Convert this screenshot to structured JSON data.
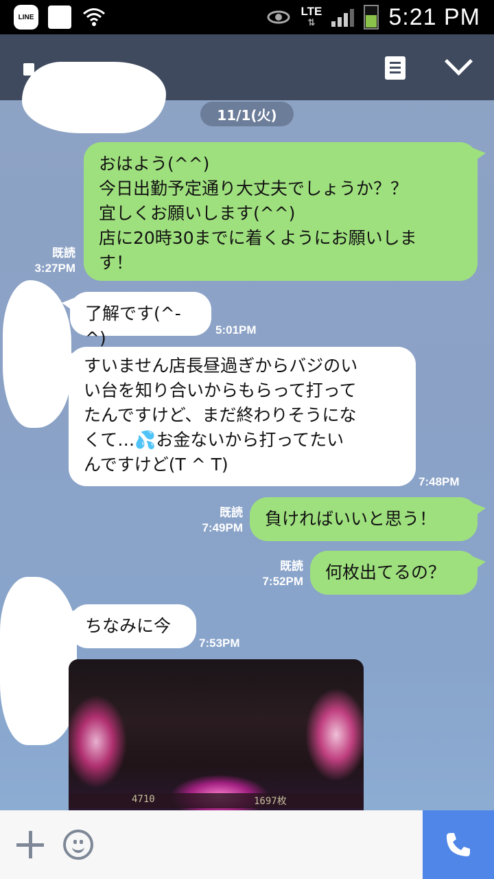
{
  "status_bar": {
    "line_label": "LINE",
    "network": "LTE",
    "time": "5:21 PM"
  },
  "header": {
    "icons": [
      "lock-icon",
      "notes-icon",
      "chevron-down-icon"
    ]
  },
  "chat": {
    "date": "11/1(火)",
    "read_label": "既読",
    "messages": [
      {
        "side": "sent",
        "text": "おはよう(^^)\n今日出勤予定通り大丈夫でしょうか？？\n宜しくお願いします(^^)\n店に20時30までに着くようにお願いしま\nす！",
        "time": "3:27PM",
        "read": "既読"
      },
      {
        "side": "recv",
        "text": "了解です(^-^)",
        "time": "5:01PM"
      },
      {
        "side": "recv",
        "text": "すいません店長昼過ぎからバジのい\nい台を知り合いからもらって打って\nたんですけど、まだ終わりそうにな\nくて…💦お金ないから打ってたい\nんですけど(T ^ T)",
        "time": "7:48PM"
      },
      {
        "side": "sent",
        "text": "負ければいいと思う！",
        "time": "7:49PM",
        "read": "既読"
      },
      {
        "side": "sent",
        "text": "何枚出てるの？",
        "time": "7:52PM",
        "read": "既読"
      },
      {
        "side": "recv",
        "text": "ちなみに今",
        "time": "7:53PM"
      }
    ],
    "photo": {
      "left_counter": "4710",
      "right_counter": "1697枚"
    }
  },
  "input_bar": {
    "icons": [
      "plus-icon",
      "emoji-icon",
      "phone-icon"
    ],
    "call_color": "#4f86e8"
  }
}
